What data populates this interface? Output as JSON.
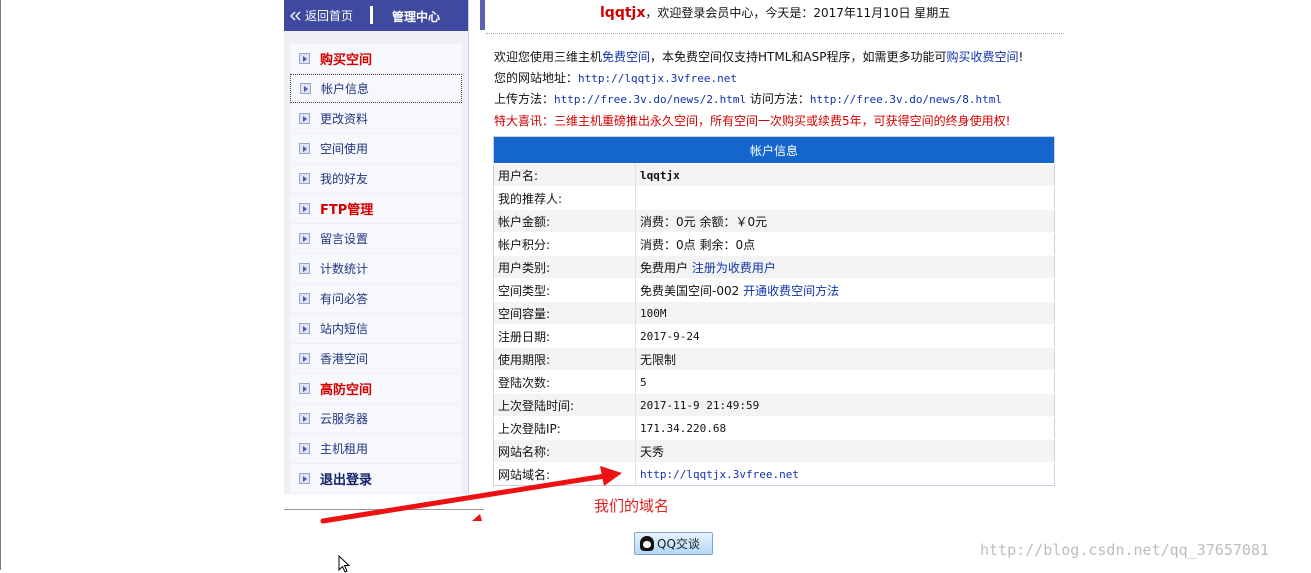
{
  "sidebar": {
    "back_label": "返回首页",
    "panel_title": "管理中心",
    "items": [
      {
        "label": "购买空间",
        "style": "red"
      },
      {
        "label": "帐户信息",
        "style": "normal"
      },
      {
        "label": "更改资料",
        "style": "normal"
      },
      {
        "label": "空间使用",
        "style": "normal"
      },
      {
        "label": "我的好友",
        "style": "normal"
      },
      {
        "label": "FTP管理",
        "style": "red"
      },
      {
        "label": "留言设置",
        "style": "normal"
      },
      {
        "label": "计数统计",
        "style": "normal"
      },
      {
        "label": "有问必答",
        "style": "normal"
      },
      {
        "label": "站内短信",
        "style": "normal"
      },
      {
        "label": "香港空间",
        "style": "normal"
      },
      {
        "label": "高防空间",
        "style": "red"
      },
      {
        "label": "云服务器",
        "style": "normal"
      },
      {
        "label": "主机租用",
        "style": "normal"
      },
      {
        "label": "退出登录",
        "style": "bold"
      }
    ]
  },
  "header": {
    "username": "lqqtjx",
    "greeting_text": "，欢迎登录会员中心，今天是：2017年11月10日 星期五"
  },
  "intro": {
    "l1_a": "欢迎您使用三维主机",
    "l1_link1": "免费空间",
    "l1_b": "，本免费空间仅支持HTML和ASP程序，如需更多功能可",
    "l1_link2": "购买收费空间",
    "l1_c": "!",
    "l2_label": "您的网站地址：",
    "l2_url": "http://lqqtjx.3vfree.net",
    "l3_label": "上传方法：",
    "l3_url1": "http://free.3v.do/news/2.html",
    "l3_mid": " 访问方法：",
    "l3_url2": "http://free.3v.do/news/8.html",
    "l4": "特大喜讯：三维主机重磅推出永久空间，所有空间一次购买或续费5年，可获得空间的终身使用权!"
  },
  "account_table": {
    "title": "帐户信息",
    "rows": [
      {
        "key": "用户名:",
        "value": "lqqtjx"
      },
      {
        "key": "我的推荐人:",
        "value": ""
      },
      {
        "key": "帐户金额:",
        "value": "消费：0元 余额：￥0元"
      },
      {
        "key": "帐户积分:",
        "value": "消费：0点 剩余：0点"
      },
      {
        "key": "用户类别:",
        "value": "免费用户",
        "link": "注册为收费用户"
      },
      {
        "key": "空间类型:",
        "value": "免费美国空间-002",
        "link": "开通收费空间方法"
      },
      {
        "key": "空间容量:",
        "value": "100M"
      },
      {
        "key": "注册日期:",
        "value": "2017-9-24"
      },
      {
        "key": "使用期限:",
        "value": "无限制"
      },
      {
        "key": "登陆次数:",
        "value": "5"
      },
      {
        "key": "上次登陆时间:",
        "value": "2017-11-9 21:49:59"
      },
      {
        "key": "上次登陆IP:",
        "value": "171.34.220.68"
      },
      {
        "key": "网站名称:",
        "value": "天秀"
      },
      {
        "key": "网站域名:",
        "link": "http://lqqtjx.3vfree.net"
      }
    ]
  },
  "annotation": "我们的域名",
  "qq_button": "QQ交谈",
  "watermark": "http://blog.csdn.net/qq_37657081",
  "colors": {
    "sidebar_header": "#3f4a9e",
    "table_header": "#1466cc",
    "accent_red": "#d40000",
    "link_blue": "#1133aa",
    "arrow_red": "#ee1111"
  }
}
